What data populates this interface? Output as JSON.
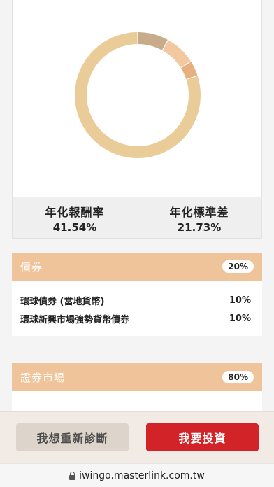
{
  "colors": {
    "accent_header": "#efc49a",
    "invest_button": "#d22428",
    "rediagnose_button": "#ddd4cb",
    "tab_left": "#e8a8a0",
    "tab_right": "#e06a60"
  },
  "chart_data": {
    "type": "pie",
    "style": "donut",
    "slices": [
      {
        "value": 80,
        "color": "#e9cc98"
      },
      {
        "value": 8,
        "color": "#c8ab8a"
      },
      {
        "value": 8,
        "color": "#f1c8a0"
      },
      {
        "value": 4,
        "color": "#e8b080"
      }
    ]
  },
  "stats": {
    "annual_return_label": "年化報酬率",
    "annual_return_value": "41.54%",
    "annual_std_label": "年化標準差",
    "annual_std_value": "21.73%"
  },
  "sections": {
    "bonds": {
      "title": "債券",
      "percent": "20%",
      "funds": [
        {
          "name": "環球債券 (當地貨幣)",
          "percent": "10%"
        },
        {
          "name": "環球新興市場強勢貨幣債券",
          "percent": "10%"
        }
      ]
    },
    "equities": {
      "title": "證券市場",
      "percent": "80%"
    }
  },
  "actions": {
    "rediagnose_label": "我想重新診斷",
    "invest_label": "我要投資"
  },
  "browser": {
    "url": "iwingo.masterlink.com.tw",
    "lock_icon": "lock-icon"
  }
}
